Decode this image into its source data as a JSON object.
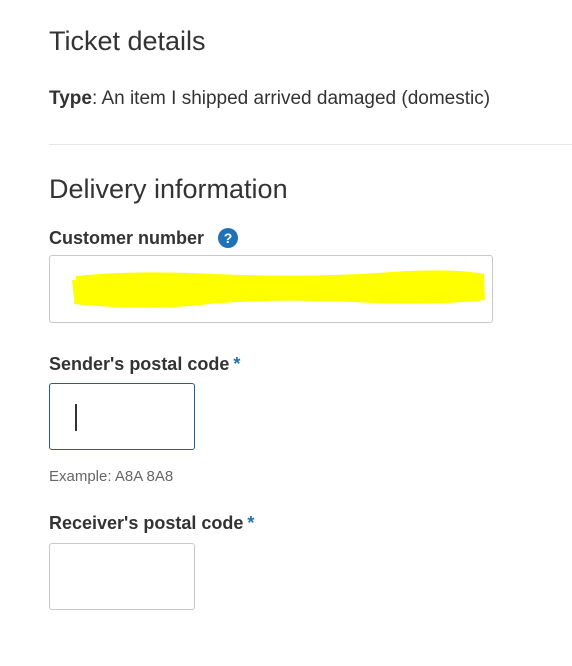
{
  "ticket": {
    "title": "Ticket details",
    "type_label": "Type",
    "type_value": ": An item I shipped arrived damaged (domestic)"
  },
  "delivery": {
    "title": "Delivery information",
    "customer_number": {
      "label": "Customer number",
      "help_icon": "?",
      "value": "",
      "redacted": true,
      "redaction_color": "#ffff00"
    },
    "sender_postal": {
      "label": "Sender's postal code",
      "required_marker": "*",
      "value": "",
      "focused": true,
      "example": "Example: A8A 8A8"
    },
    "receiver_postal": {
      "label": "Receiver's postal code",
      "required_marker": "*",
      "value": ""
    }
  },
  "colors": {
    "accent": "#1f72b8",
    "text": "#333333",
    "border": "#c8c8c8",
    "focus_border": "#1f5f9a"
  }
}
